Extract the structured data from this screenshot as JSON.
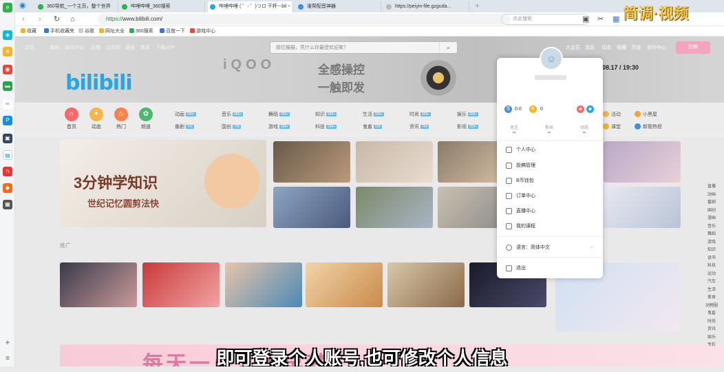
{
  "browser": {
    "tabs": [
      {
        "title": "360导航_一个主页，整个世界",
        "active": false
      },
      {
        "title": "哔哩哔哩_360搜索",
        "active": false
      },
      {
        "title": "哔哩哔哩 ( ゜- ゜)つロ 干杯~-bil",
        "active": true
      },
      {
        "title": "谁帮配音神器",
        "active": false
      },
      {
        "title": "https://peiyin-file.gzguda...",
        "active": false
      }
    ],
    "url_scheme": "https://",
    "url_host": "www.bilibili.com/",
    "search_placeholder": "点此搜索",
    "bookmarks": [
      "收藏",
      "手机收藏夹",
      "谷歌",
      "网址大全",
      "360搜索",
      "百度一下",
      "游戏中心"
    ]
  },
  "site": {
    "logo": "bilibili",
    "topnav": [
      "主站",
      "番剧",
      "游戏中心",
      "直播",
      "会员购",
      "漫画",
      "赛事",
      "下载APP"
    ],
    "search_placeholder": "那位猫猫，凭什么你最受欢迎笑？",
    "topnav_right": [
      "大会员",
      "消息",
      "动态",
      "收藏",
      "历史",
      "创作中心"
    ],
    "login_button": "投稿",
    "banner_logo": "iQOO",
    "banner_text_1": "全感操控",
    "banner_text_2": "一触即发",
    "banner_date": "08.17 / 19:30",
    "channels": [
      {
        "label": "首页",
        "icon": "⌂",
        "color": "#f26a6a"
      },
      {
        "label": "动态",
        "icon": "✦",
        "color": "#f4b54a"
      },
      {
        "label": "热门",
        "icon": "♨",
        "color": "#f2834e"
      },
      {
        "label": "频道",
        "icon": "✿",
        "color": "#4cb86b"
      }
    ],
    "categories_row1": [
      "动画",
      "音乐",
      "舞蹈",
      "知识",
      "生活",
      "时尚",
      "娱乐"
    ],
    "categories_row2": [
      "番剧",
      "国创",
      "游戏",
      "科技",
      "鬼畜",
      "资讯",
      "影视"
    ],
    "category_badges_row1": [
      "999+",
      "999+",
      "999+",
      "999+",
      "999+",
      "999+",
      "999+"
    ],
    "category_badges_row2": [
      "141",
      "706",
      "999+",
      "999+",
      "620",
      "754",
      "999+"
    ],
    "extra_links": [
      "活动",
      "小黑屋",
      "课堂",
      "新歌热榜"
    ],
    "featured_title": "3分钟学知识",
    "featured_subtitle": "世纪记忆圆剪法快",
    "section_label": "推广",
    "right_tags": [
      "直播",
      "动画",
      "番剧",
      "国创",
      "漫画",
      "音乐",
      "舞蹈",
      "游戏",
      "知识",
      "读书",
      "科技",
      "运动",
      "汽车",
      "生活",
      "美食",
      "动物圈",
      "鬼畜",
      "时尚",
      "资讯",
      "娱乐",
      "专栏"
    ],
    "banner_bottom_text": "每天一点，不早梦"
  },
  "user_popup": {
    "coins": "0.0",
    "bcoins": "0",
    "stats": [
      {
        "label": "关注",
        "value": "--"
      },
      {
        "label": "粉丝",
        "value": "--"
      },
      {
        "label": "动态",
        "value": "--"
      }
    ],
    "menu": [
      "个人中心",
      "投稿管理",
      "B币钱包",
      "订单中心",
      "直播中心",
      "我的课程"
    ],
    "language": "语言：简体中文",
    "logout": "退出"
  },
  "overlay": {
    "subtitle": "即可登录个人账号,也可修改个人信息",
    "brand": "简调·视频"
  }
}
